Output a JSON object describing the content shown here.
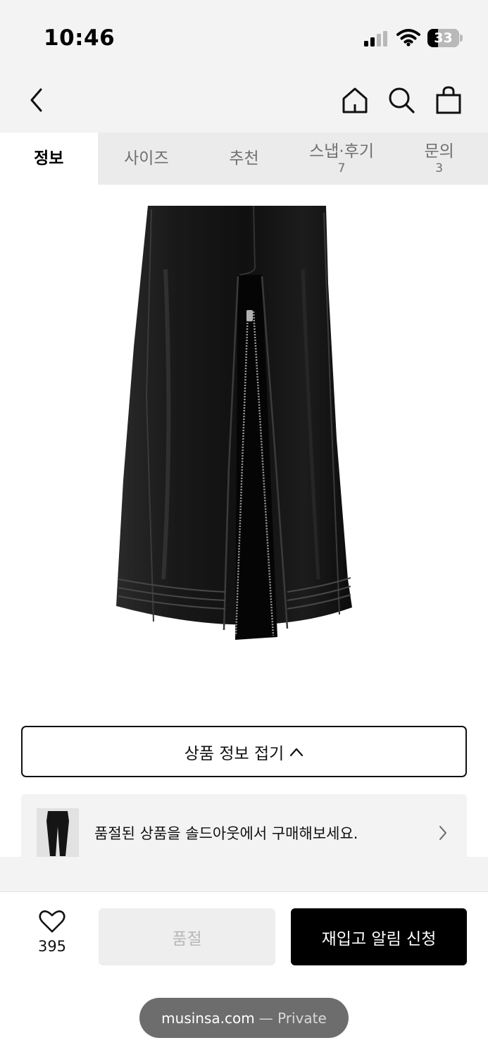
{
  "status_bar": {
    "time": "10:46",
    "battery_level": "33",
    "icons": [
      "cellular-signal-icon",
      "wifi-icon",
      "battery-icon"
    ]
  },
  "nav": {
    "icons": [
      "back-chevron-icon",
      "home-icon",
      "search-icon",
      "shopping-bag-icon"
    ]
  },
  "tabs": [
    {
      "label": "정보",
      "count": "",
      "active": true
    },
    {
      "label": "사이즈",
      "count": ""
    },
    {
      "label": "추천",
      "count": ""
    },
    {
      "label": "스냅·후기",
      "count": "7"
    },
    {
      "label": "문의",
      "count": "3"
    }
  ],
  "product": {
    "collapse_label": "상품 정보 접기"
  },
  "soldout_banner": {
    "text": "품절된 상품을 솔드아웃에서 구매해보세요."
  },
  "bottom_bar": {
    "like_count": "395",
    "soldout_label": "품절",
    "restock_label": "재입고 알림 신청"
  },
  "browser": {
    "url": "musinsa.com",
    "mode": "— Private"
  },
  "colors": {
    "header_bg": "#f3f3f3",
    "primary_button": "#000000",
    "disabled_button": "#eeeeee",
    "product": "#1a1a1a"
  }
}
